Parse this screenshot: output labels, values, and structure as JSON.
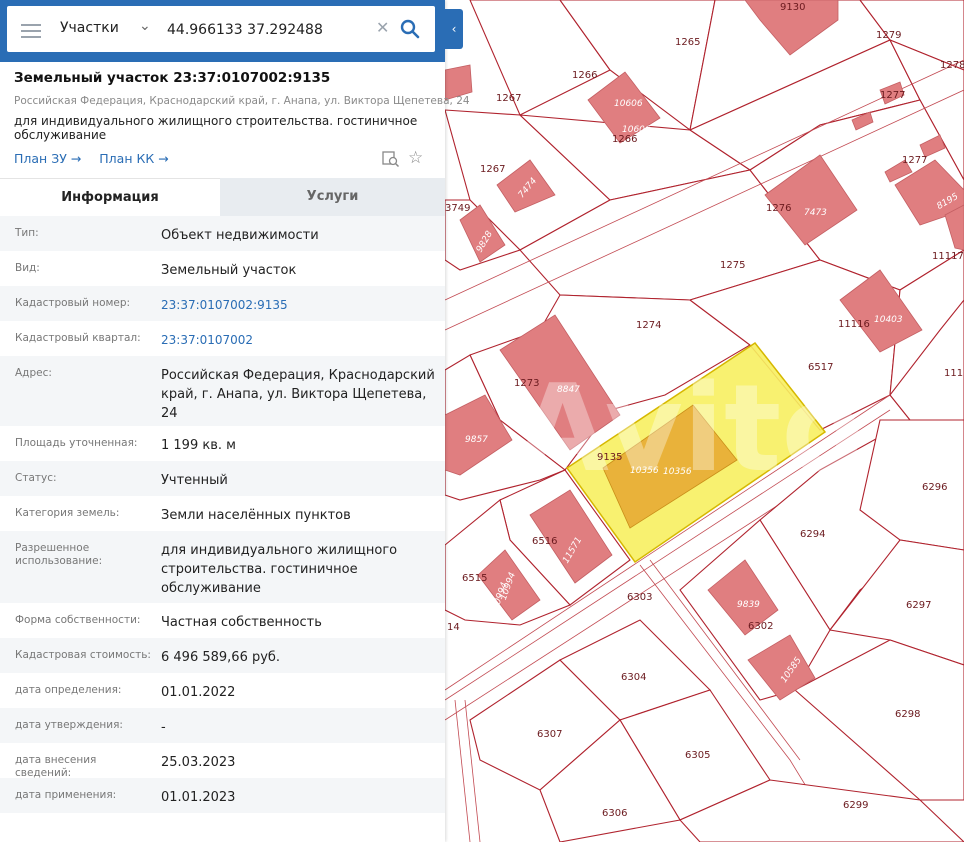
{
  "search": {
    "mode": "Участки",
    "query": "44.966133 37.292488"
  },
  "parcel": {
    "title": "Земельный участок 23:37:0107002:9135",
    "address": "Российская Федерация, Краснодарский край, г. Анапа, ул. Виктора Щепетева, 24",
    "purpose": "для индивидуального жилищного строительства. гостиничное обслуживание",
    "link_plan_zu": "План ЗУ →",
    "link_plan_kk": "План КК →"
  },
  "tabs": {
    "info": "Информация",
    "services": "Услуги"
  },
  "props": [
    {
      "label": "Тип:",
      "value": "Объект недвижимости"
    },
    {
      "label": "Вид:",
      "value": "Земельный участок"
    },
    {
      "label": "Кадастровый номер:",
      "value": "23:37:0107002:9135"
    },
    {
      "label": "Кадастровый квартал:",
      "value": "23:37:0107002"
    },
    {
      "label": "Адрес:",
      "value": "Российская Федерация, Краснодарский край, г. Анапа, ул. Виктора Щепетева, 24"
    },
    {
      "label": "Площадь уточненная:",
      "value": "1 199 кв. м"
    },
    {
      "label": "Статус:",
      "value": "Учтенный"
    },
    {
      "label": "Категория земель:",
      "value": "Земли населённых пунктов"
    },
    {
      "label": "Разрешенное использование:",
      "value": "для индивидуального жилищного строительства. гостиничное обслуживание"
    },
    {
      "label": "Форма собственности:",
      "value": "Частная собственность"
    },
    {
      "label": "Кадастровая стоимость:",
      "value": "6 496 589,66 руб."
    },
    {
      "label": "дата определения:",
      "value": "01.01.2022"
    },
    {
      "label": "дата утверждения:",
      "value": "-"
    },
    {
      "label": "дата внесения сведений:",
      "value": "25.03.2023"
    },
    {
      "label": "дата применения:",
      "value": "01.01.2023"
    }
  ],
  "map": {
    "labels": {
      "l9130": "9130",
      "l1265": "1265",
      "l1279": "1279",
      "l1278": "1278",
      "l1266a": "1266",
      "l1266b": "1266",
      "l10606a": "10606",
      "l10606b": "10606",
      "l1267a": "1267",
      "l1267b": "1267",
      "l7474": "7474",
      "l1277a": "1277",
      "l1277b": "1277",
      "l1276": "1276",
      "l7473": "7473",
      "l8195": "8195",
      "l3749": "3749",
      "l9828": "9828",
      "l1275": "1275",
      "l11117": "11117",
      "l1274": "1274",
      "l11116": "11116",
      "l10403": "10403",
      "l6517": "6517",
      "l1273": "1273",
      "l8847": "8847",
      "l111": "111",
      "l9857": "9857",
      "l9135": "9135",
      "l10356a": "10356",
      "l10356b": "10356",
      "l6296": "6296",
      "l6516": "6516",
      "l11571": "11571",
      "l6294": "6294",
      "l6515": "6515",
      "l10994a": "10994",
      "l10994b": "10994",
      "l6303": "6303",
      "l14": "14",
      "l9839": "9839",
      "l6302": "6302",
      "l6297": "6297",
      "l10585": "10585",
      "l6304": "6304",
      "l6298": "6298",
      "l6307": "6307",
      "l6305": "6305",
      "l6306": "6306",
      "l6299": "6299"
    }
  }
}
